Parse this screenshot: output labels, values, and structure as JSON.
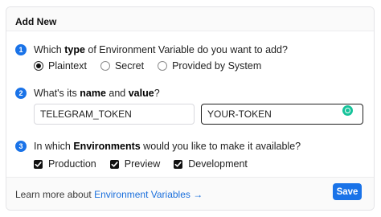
{
  "header": {
    "title": "Add New"
  },
  "step1": {
    "number": "1",
    "q_before": "Which ",
    "q_bold": "type",
    "q_after": " of Environment Variable do you want to add?",
    "options": [
      {
        "label": "Plaintext",
        "selected": true
      },
      {
        "label": "Secret",
        "selected": false
      },
      {
        "label": "Provided by System",
        "selected": false
      }
    ]
  },
  "step2": {
    "number": "2",
    "q_before": "What's its ",
    "q_bold1": "name",
    "q_mid": " and ",
    "q_bold2": "value",
    "q_after": "?",
    "name_value": "TELEGRAM_TOKEN",
    "value_value": "YOUR-TOKEN"
  },
  "step3": {
    "number": "3",
    "q_before": "In which ",
    "q_bold": "Environments",
    "q_after": " would you like to make it available?",
    "environments": [
      {
        "label": "Production",
        "checked": true
      },
      {
        "label": "Preview",
        "checked": true
      },
      {
        "label": "Development",
        "checked": true
      }
    ]
  },
  "footer": {
    "learn_prefix": "Learn more about ",
    "learn_link": "Environment Variables →",
    "save_label": "Save"
  },
  "colors": {
    "accent": "#1a73e8",
    "grammarly": "#15c39a"
  }
}
